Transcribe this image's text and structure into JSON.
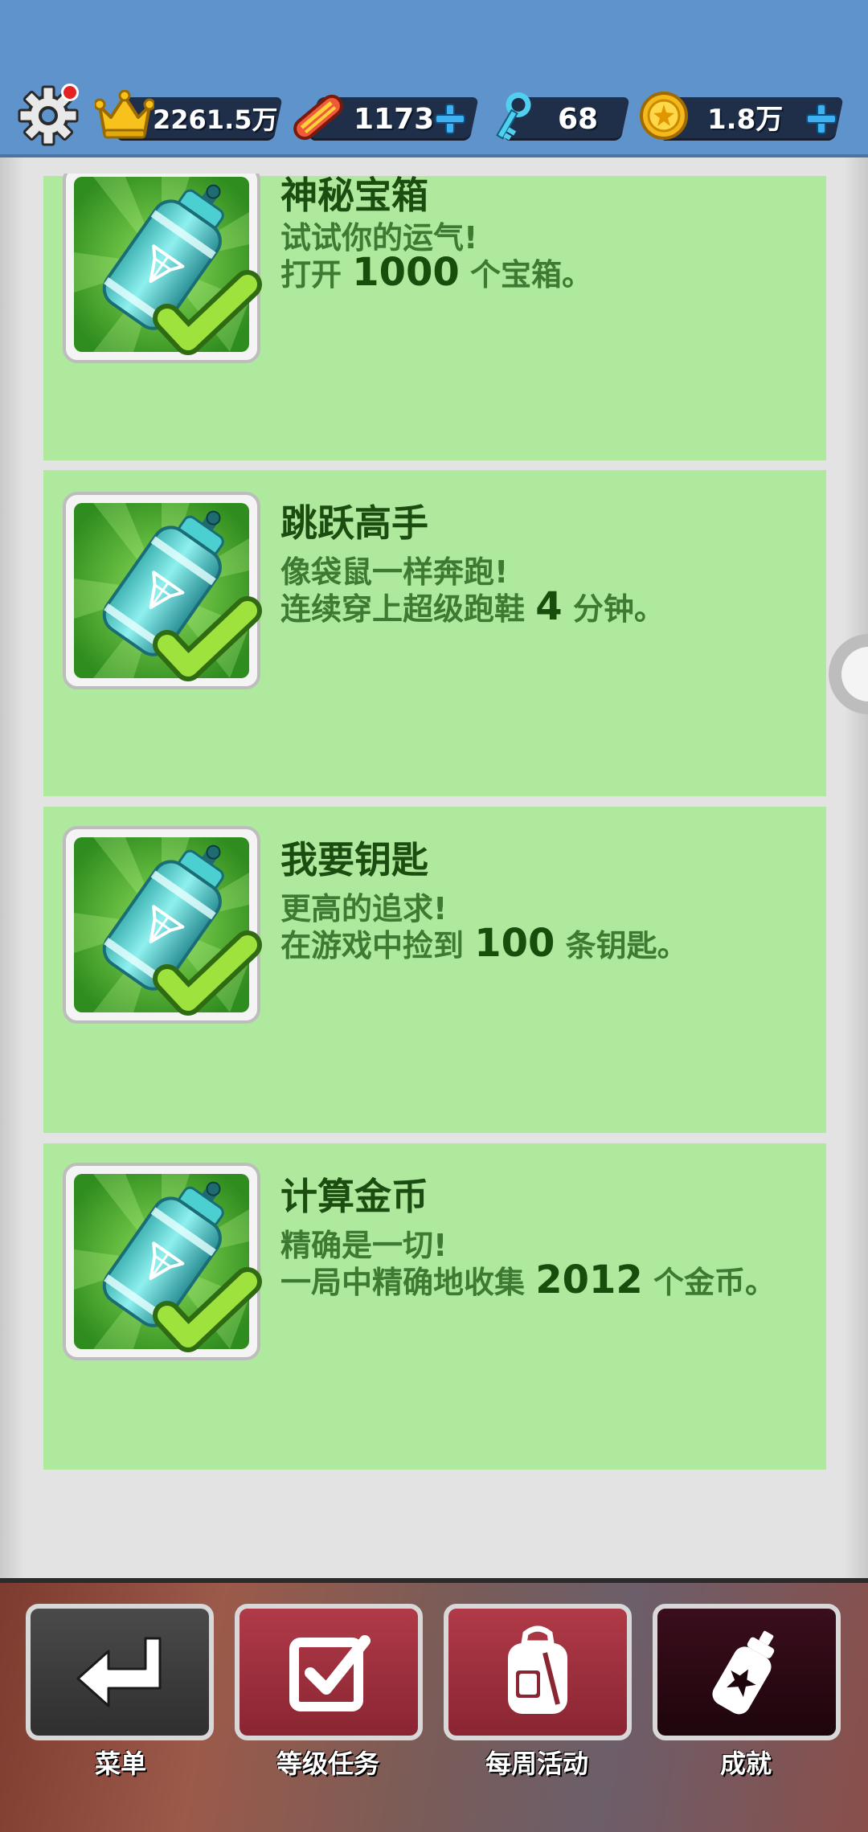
{
  "hud": {
    "score": "2261.5万",
    "boards": "1173",
    "keys": "68",
    "coins": "1.8万"
  },
  "achievements": [
    {
      "title": "神秘宝箱",
      "desc": "试试你的运气!",
      "line2_pre": "打开 ",
      "line2_num": "1000",
      "line2_post": " 个宝箱。"
    },
    {
      "title": "跳跃高手",
      "desc": "像袋鼠一样奔跑!",
      "line2_pre": "连续穿上超级跑鞋 ",
      "line2_num": "4",
      "line2_post": " 分钟。"
    },
    {
      "title": "我要钥匙",
      "desc": "更高的追求!",
      "line2_pre": "在游戏中捡到 ",
      "line2_num": "100",
      "line2_post": " 条钥匙。"
    },
    {
      "title": "计算金币",
      "desc": "精确是一切!",
      "line2_pre": "一局中精确地收集 ",
      "line2_num": "2012",
      "line2_post": " 个金币。"
    }
  ],
  "nav": {
    "menu": "菜单",
    "level_tasks": "等级任务",
    "weekly": "每周活动",
    "achievements": "成就"
  },
  "colors": {
    "card_bg": "#aee99e",
    "sky": "#5f93cc",
    "nav_dark": "#3a3a3a",
    "nav_red": "#9c2f3c",
    "nav_active": "#2a0a14"
  },
  "icons": {
    "settings": "gear-icon",
    "score": "crown-icon",
    "boards": "hoverboard-icon",
    "keys": "key-icon",
    "coins": "coin-icon",
    "achievement": "spray-can-icon",
    "completed": "checkmark-icon"
  }
}
